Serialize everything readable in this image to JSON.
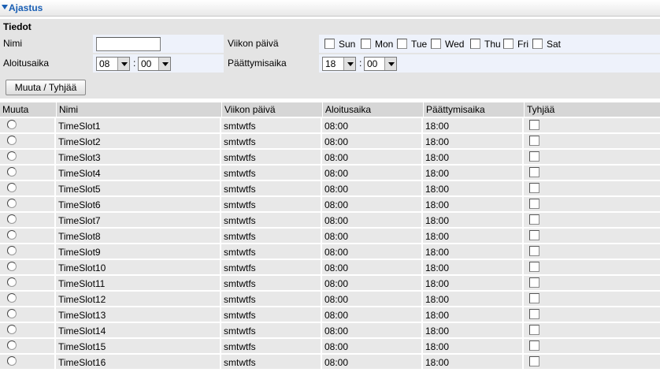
{
  "section": {
    "title": "Ajastus"
  },
  "form": {
    "title": "Tiedot",
    "name_label": "Nimi",
    "name_value": "",
    "weekday_label": "Viikon päivä",
    "days": [
      "Sun",
      "Mon",
      "Tue",
      "Wed",
      "Thu",
      "Fri",
      "Sat"
    ],
    "start_label": "Aloitusaika",
    "start_hour": "08",
    "start_minute": "00",
    "end_label": "Päättymisaika",
    "end_hour": "18",
    "end_minute": "00",
    "colon": ":",
    "button_label": "Muuta / Tyhjää"
  },
  "table": {
    "headers": [
      "Muuta",
      "Nimi",
      "Viikon päivä",
      "Aloitusaika",
      "Päättymisaika",
      "Tyhjää"
    ],
    "rows": [
      {
        "name": "TimeSlot1",
        "days": "smtwtfs",
        "start": "08:00",
        "end": "18:00"
      },
      {
        "name": "TimeSlot2",
        "days": "smtwtfs",
        "start": "08:00",
        "end": "18:00"
      },
      {
        "name": "TimeSlot3",
        "days": "smtwtfs",
        "start": "08:00",
        "end": "18:00"
      },
      {
        "name": "TimeSlot4",
        "days": "smtwtfs",
        "start": "08:00",
        "end": "18:00"
      },
      {
        "name": "TimeSlot5",
        "days": "smtwtfs",
        "start": "08:00",
        "end": "18:00"
      },
      {
        "name": "TimeSlot6",
        "days": "smtwtfs",
        "start": "08:00",
        "end": "18:00"
      },
      {
        "name": "TimeSlot7",
        "days": "smtwtfs",
        "start": "08:00",
        "end": "18:00"
      },
      {
        "name": "TimeSlot8",
        "days": "smtwtfs",
        "start": "08:00",
        "end": "18:00"
      },
      {
        "name": "TimeSlot9",
        "days": "smtwtfs",
        "start": "08:00",
        "end": "18:00"
      },
      {
        "name": "TimeSlot10",
        "days": "smtwtfs",
        "start": "08:00",
        "end": "18:00"
      },
      {
        "name": "TimeSlot11",
        "days": "smtwtfs",
        "start": "08:00",
        "end": "18:00"
      },
      {
        "name": "TimeSlot12",
        "days": "smtwtfs",
        "start": "08:00",
        "end": "18:00"
      },
      {
        "name": "TimeSlot13",
        "days": "smtwtfs",
        "start": "08:00",
        "end": "18:00"
      },
      {
        "name": "TimeSlot14",
        "days": "smtwtfs",
        "start": "08:00",
        "end": "18:00"
      },
      {
        "name": "TimeSlot15",
        "days": "smtwtfs",
        "start": "08:00",
        "end": "18:00"
      },
      {
        "name": "TimeSlot16",
        "days": "smtwtfs",
        "start": "08:00",
        "end": "18:00"
      }
    ]
  },
  "colors": {
    "accent": "#1a5fb4",
    "form_bg": "#e4e4e4",
    "value_bg": "#eef2fb",
    "row_bg": "#e8e8e8",
    "header_bg": "#d6d6d6"
  }
}
